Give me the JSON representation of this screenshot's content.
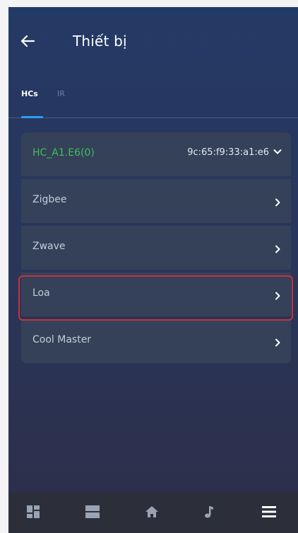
{
  "header": {
    "title": "Thiết bị",
    "back_icon": "arrow-left-icon"
  },
  "tabs": [
    {
      "label": "HCs",
      "active": true
    },
    {
      "label": "IR",
      "active": false
    }
  ],
  "device": {
    "name": "HC_A1.E6(0)",
    "mac": "9c:65:f9:33:a1:e6",
    "icon": "chevron-down-icon"
  },
  "items": [
    {
      "label": "Zigbee",
      "icon": "chevron-right-icon"
    },
    {
      "label": "Zwave",
      "icon": "chevron-right-icon"
    },
    {
      "label": "Loa",
      "icon": "chevron-right-icon",
      "highlighted": true
    },
    {
      "label": "Cool Master",
      "icon": "chevron-right-icon"
    }
  ],
  "bottom_nav": [
    {
      "icon": "dashboard-icon"
    },
    {
      "icon": "list-icon"
    },
    {
      "icon": "home-icon"
    },
    {
      "icon": "music-note-icon"
    },
    {
      "icon": "menu-icon"
    }
  ],
  "colors": {
    "accent": "#2d9cf0",
    "highlight": "#c8323c",
    "device_name": "#3fbf5f",
    "row_bg": "#354158",
    "nav_bg": "#2c2f3a"
  }
}
